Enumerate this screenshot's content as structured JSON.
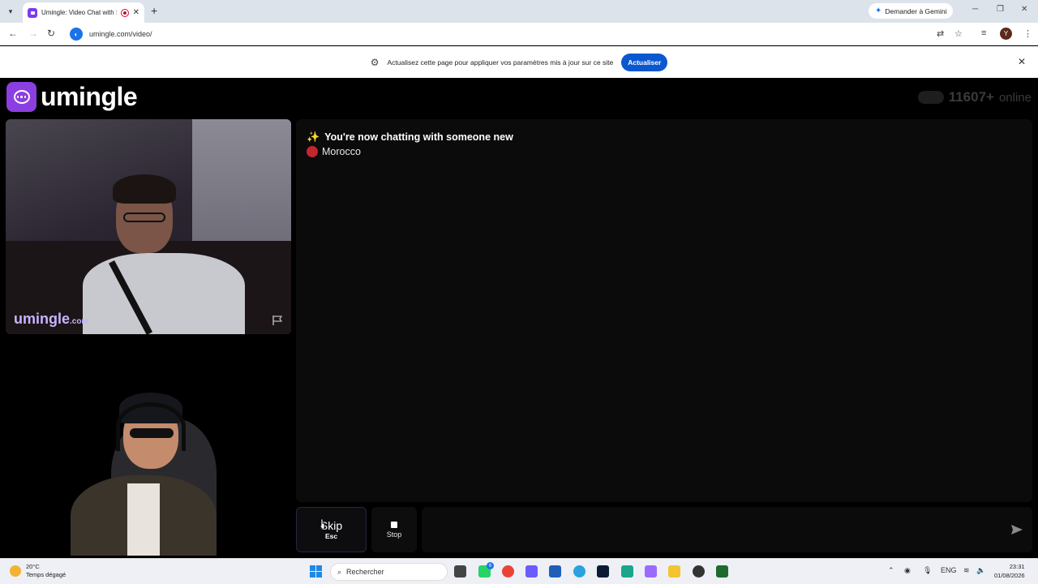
{
  "browser": {
    "tab_title": "Umingle: Video Chat with S",
    "new_tab": "+",
    "gemini_label": "Demander à Gemini",
    "url": "umingle.com/video/",
    "profile_initial": "Y"
  },
  "infobar": {
    "message": "Actualisez cette page pour appliquer vos paramètres mis à jour sur ce site",
    "button": "Actualiser"
  },
  "app": {
    "logo_text": "umingle",
    "online_count": "11607+",
    "online_label": "online",
    "watermark_main": "umingle",
    "watermark_suffix": ".com"
  },
  "chat": {
    "status_message": "You're now chatting with someone new",
    "country": "Morocco",
    "country_flag_color": "#c1272d"
  },
  "controls": {
    "skip_label": "Skip",
    "skip_key": "Esc",
    "stop_label": "Stop",
    "message_placeholder": ""
  },
  "taskbar": {
    "weather_temp": "20°C",
    "weather_desc": "Temps dégagé",
    "search_placeholder": "Rechercher",
    "whatsapp_badge": "6",
    "language": "ENG",
    "time": "23:31",
    "date": "01/08/2026"
  },
  "colors": {
    "brand_purple": "#8b3fe0",
    "accent_blue": "#0b57d0"
  }
}
